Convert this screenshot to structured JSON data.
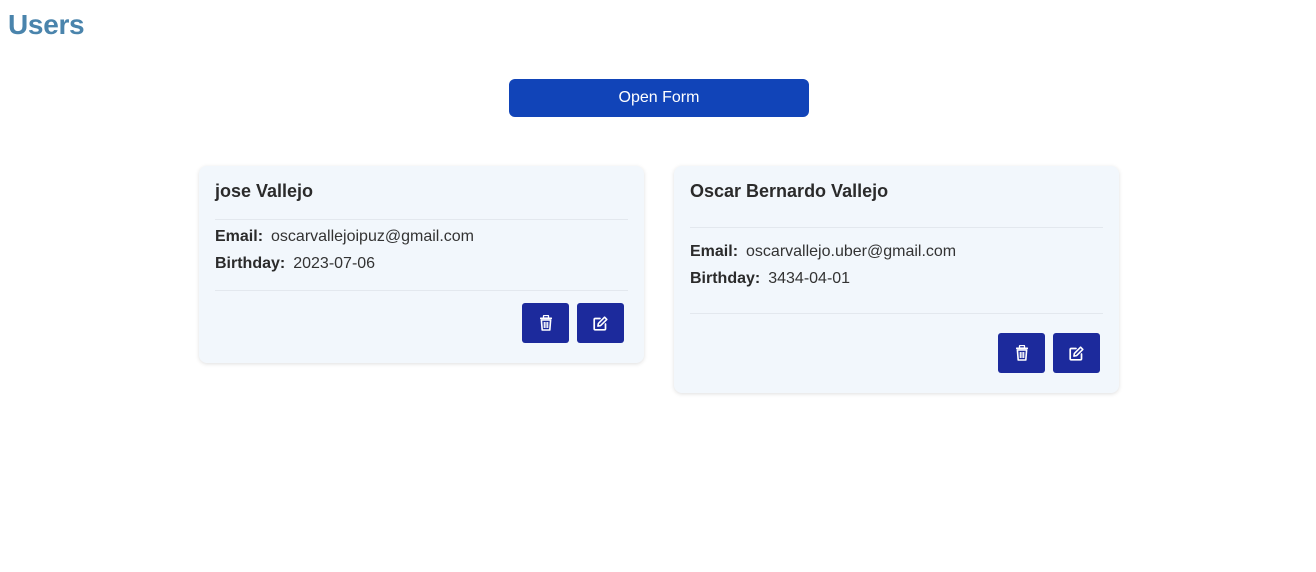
{
  "page": {
    "title": "Users"
  },
  "actions": {
    "open_form_label": "Open Form"
  },
  "users": [
    {
      "name": "jose Vallejo",
      "email_label": "Email:",
      "email": "oscarvallejoipuz@gmail.com",
      "birthday_label": "Birthday:",
      "birthday": "2023-07-06",
      "delete_icon": "trash-icon",
      "edit_icon": "edit-icon"
    },
    {
      "name": "Oscar Bernardo Vallejo",
      "email_label": "Email:",
      "email": "oscarvallejo.uber@gmail.com",
      "birthday_label": "Birthday:",
      "birthday": "3434-04-01",
      "delete_icon": "trash-icon",
      "edit_icon": "edit-icon"
    }
  ],
  "colors": {
    "title": "#4a84ac",
    "primary_button": "#1144b8",
    "action_button": "#1c2a9c",
    "card_background": "#f2f7fc"
  }
}
